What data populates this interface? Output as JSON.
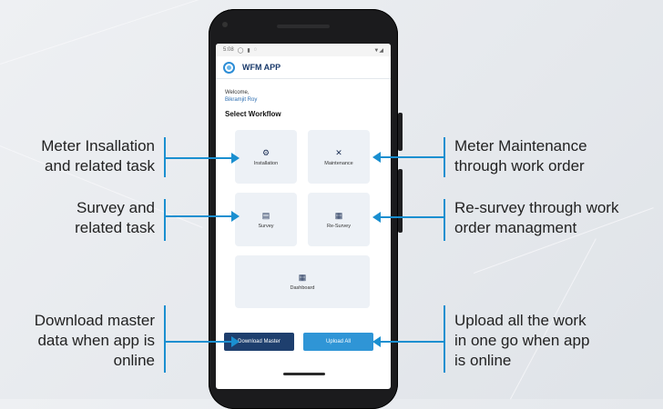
{
  "app": {
    "title": "WFM APP",
    "status_time": "5:08",
    "welcome_text": "Welcome,",
    "user_name": "Bikramjit Roy",
    "section_title": "Select Workflow"
  },
  "workflow": [
    {
      "label": "Installation",
      "icon": "gear-icon"
    },
    {
      "label": "Maintenance",
      "icon": "tools-icon"
    },
    {
      "label": "Survey",
      "icon": "document-icon"
    },
    {
      "label": "Re-Survey",
      "icon": "documents-icon"
    },
    {
      "label": "Dashboard",
      "icon": "dashboard-icon"
    }
  ],
  "buttons": {
    "download": "Download Master",
    "upload": "Upload All"
  },
  "colors": {
    "accent": "#1a8fd0",
    "download_button": "#1e3f6e",
    "upload_button": "#2f95d6",
    "tile_bg": "#edf1f6"
  },
  "annotations": {
    "installation": [
      "Meter Insallation",
      "and related task"
    ],
    "maintenance": [
      "Meter Maintenance",
      "through work order"
    ],
    "survey": [
      "Survey and",
      "related task"
    ],
    "resurvey": [
      "Re-survey through work",
      "order managment"
    ],
    "download": [
      "Download master",
      "data when app is",
      "online"
    ],
    "upload": [
      "Upload all the work",
      "in one go when app",
      "is online"
    ]
  }
}
